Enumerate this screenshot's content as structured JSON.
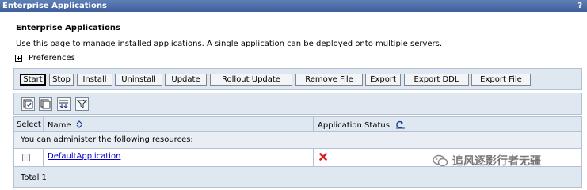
{
  "titlebar": {
    "title": "Enterprise Applications",
    "help": "?"
  },
  "page": {
    "heading": "Enterprise Applications",
    "description": "Use this page to manage installed applications. A single application can be deployed onto multiple servers.",
    "preferences_label": "Preferences"
  },
  "buttons": {
    "start": "Start",
    "stop": "Stop",
    "install": "Install",
    "uninstall": "Uninstall",
    "update": "Update",
    "rollout_update": "Rollout Update",
    "remove_file": "Remove File",
    "export": "Export",
    "export_ddl": "Export DDL",
    "export_file": "Export File"
  },
  "toolbar_icons": [
    "select-all-icon",
    "deselect-all-icon",
    "show-filter-icon",
    "clear-filter-icon"
  ],
  "table": {
    "headers": {
      "select": "Select",
      "name": "Name",
      "status": "Application Status"
    },
    "resources_note": "You can administer the following resources:",
    "rows": [
      {
        "name": "DefaultApplication",
        "status_icon": "stopped-red-x-icon"
      }
    ],
    "total": "Total 1"
  },
  "watermark": {
    "text": "追风逐影行者无疆"
  },
  "colors": {
    "titlebar": "#3e5f9a",
    "panel": "#dfe7f1",
    "link": "#0000cc",
    "status_stopped": "#d11f1f"
  }
}
